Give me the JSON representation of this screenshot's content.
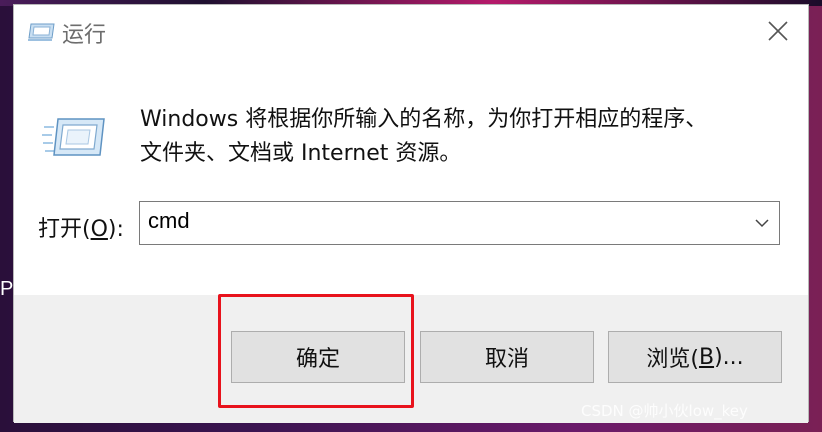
{
  "dialog": {
    "title": "运行",
    "description_line1": "Windows 将根据你所输入的名称，为你打开相应的程序、",
    "description_line2": "文件夹、文档或 Internet 资源。",
    "open_label_prefix": "打开(",
    "open_label_key": "O",
    "open_label_suffix": "):",
    "input_value": "cmd",
    "buttons": {
      "ok": "确定",
      "cancel": "取消",
      "browse_prefix": "浏览(",
      "browse_key": "B",
      "browse_suffix": ")..."
    }
  },
  "background": {
    "edge_letter": "P",
    "watermark": "CSDN @帅小伙low_key"
  },
  "colors": {
    "highlight": "#e8121c",
    "footer_bg": "#f0f0f0",
    "button_bg": "#e1e1e1"
  }
}
